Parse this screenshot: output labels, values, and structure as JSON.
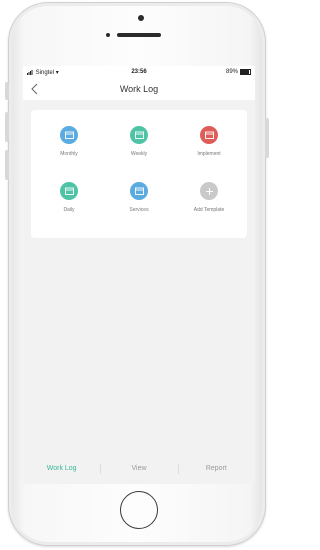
{
  "status_bar": {
    "carrier": "Singtel",
    "time": "23:56",
    "battery": "89%"
  },
  "nav": {
    "title": "Work Log"
  },
  "templates": [
    {
      "label": "Monthly",
      "color": "#5aabdf",
      "icon": "calendar-icon"
    },
    {
      "label": "Weekly",
      "color": "#4fc3a6",
      "icon": "calendar-icon"
    },
    {
      "label": "Implement",
      "color": "#de5d59",
      "icon": "calendar-icon"
    },
    {
      "label": "Daily",
      "color": "#4fc3a6",
      "icon": "calendar-icon"
    },
    {
      "label": "Services",
      "color": "#5aabdf",
      "icon": "calendar-icon"
    },
    {
      "label": "Add Template",
      "color": "#c9c9c9",
      "icon": "plus-icon"
    }
  ],
  "tabs": [
    {
      "label": "Work Log",
      "active": true
    },
    {
      "label": "View",
      "active": false
    },
    {
      "label": "Report",
      "active": false
    }
  ],
  "accent_color": "#38b99b"
}
